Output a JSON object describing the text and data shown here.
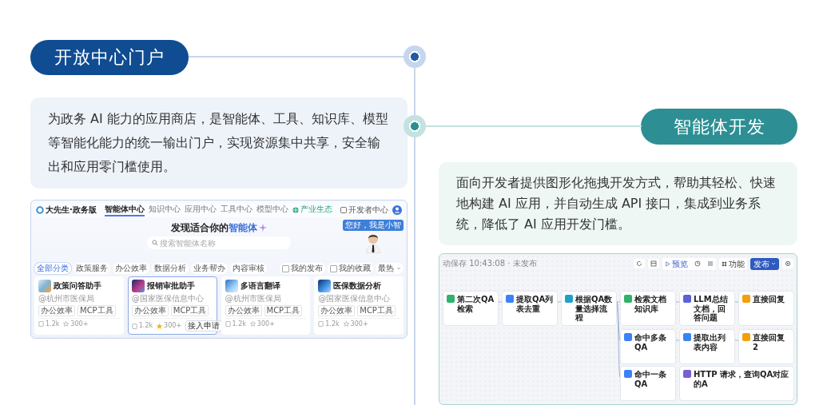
{
  "portal": {
    "title": "开放中心门户",
    "description": "为政务 AI 能力的应用商店，是智能体、工具、知识库、模型等智能化能力的统一输出门户，实现资源集中共享，安全输出和应用零门槛使用。",
    "screenshot": {
      "brand": "大先生·政务版",
      "nav": [
        {
          "label": "智能体中心",
          "kind": "tab",
          "selected": true
        },
        {
          "label": "知识中心",
          "kind": "tab",
          "selected": false
        },
        {
          "label": "应用中心",
          "kind": "tab",
          "selected": false
        },
        {
          "label": "工具中心",
          "kind": "tab",
          "selected": false
        },
        {
          "label": "模型中心",
          "kind": "tab",
          "selected": false
        },
        {
          "label": "产业生态",
          "kind": "ecosystem",
          "selected": false
        }
      ],
      "dev_link": "开发者中心",
      "hero_title": "发现适合你的",
      "hero_highlight": "智能体",
      "search": {
        "placeholder": "搜索智能体名称"
      },
      "assistant_bubble": "您好，我是小智",
      "categories": [
        {
          "label": "全部分类",
          "selected": true
        },
        {
          "label": "政策服务",
          "selected": false
        },
        {
          "label": "办公效率",
          "selected": false
        },
        {
          "label": "数据分析",
          "selected": false
        },
        {
          "label": "业务帮办",
          "selected": false
        },
        {
          "label": "内容审核",
          "selected": false
        }
      ],
      "filters": [
        {
          "kind": "checkbox",
          "label": "我的发布",
          "checked": false
        },
        {
          "kind": "checkbox",
          "label": "我的收藏",
          "checked": false
        },
        {
          "kind": "dropdown",
          "label": "最热"
        }
      ],
      "cards": [
        {
          "title": "政策问答助手",
          "org": "@杭州市医保局",
          "tags": [
            "办公效率",
            "MCP工具"
          ],
          "views": "1.2k",
          "likes": "300+",
          "liked": false,
          "selected": false
        },
        {
          "title": "报销审批助手",
          "org": "@国家医保信息中心",
          "tags": [
            "办公效率",
            "MCP工具"
          ],
          "views": "1.2k",
          "likes": "300+",
          "liked": true,
          "selected": true,
          "action": "接入申请"
        },
        {
          "title": "多语言翻译",
          "org": "@杭州市医保局",
          "tags": [
            "办公效率",
            "MCP工具"
          ],
          "views": "1.2k",
          "likes": "300+",
          "liked": false,
          "selected": false
        },
        {
          "title": "医保数据分析",
          "org": "@国家医保信息中心",
          "tags": [
            "办公效率",
            "MCP工具"
          ],
          "views": "1.2k",
          "likes": "300+",
          "liked": false,
          "selected": false
        }
      ]
    }
  },
  "agent_dev": {
    "title": "智能体开发",
    "description": "面向开发者提供图形化拖拽开发方式，帮助其轻松、快速地构建 AI 应用，并自动生成 API 接口，集成到业务系统，降低了 AI 应用开发门槛。",
    "screenshot": {
      "save_status": "动保存 10:43:08 · 未发布",
      "preview": "预览",
      "features": "功能",
      "publish": "发布",
      "nodes": [
        {
          "title": "第二次QA检索",
          "color": "#2fb36b"
        },
        {
          "title": "提取QA列表去重",
          "color": "#3b82f6"
        },
        {
          "title": "根据QA数量选择流程",
          "color": "#1fa2c7"
        },
        {
          "title": "检索文档知识库",
          "color": "#2fb36b"
        },
        {
          "title": "LLM总结文档，回答问题",
          "color": "#5a62d6"
        },
        {
          "title": "直接回复",
          "color": "#f59e0b"
        },
        {
          "title": "命中多条QA",
          "color": "#3b82f6"
        },
        {
          "title": "提取出列表内容",
          "color": "#3b82f6"
        },
        {
          "title": "直接回复 2",
          "color": "#f59e0b"
        },
        {
          "title": "命中一条QA",
          "color": "#3b82f6"
        },
        {
          "title": "HTTP 请求，查询QA对应的A",
          "color": "#7c5cd6"
        }
      ]
    }
  }
}
